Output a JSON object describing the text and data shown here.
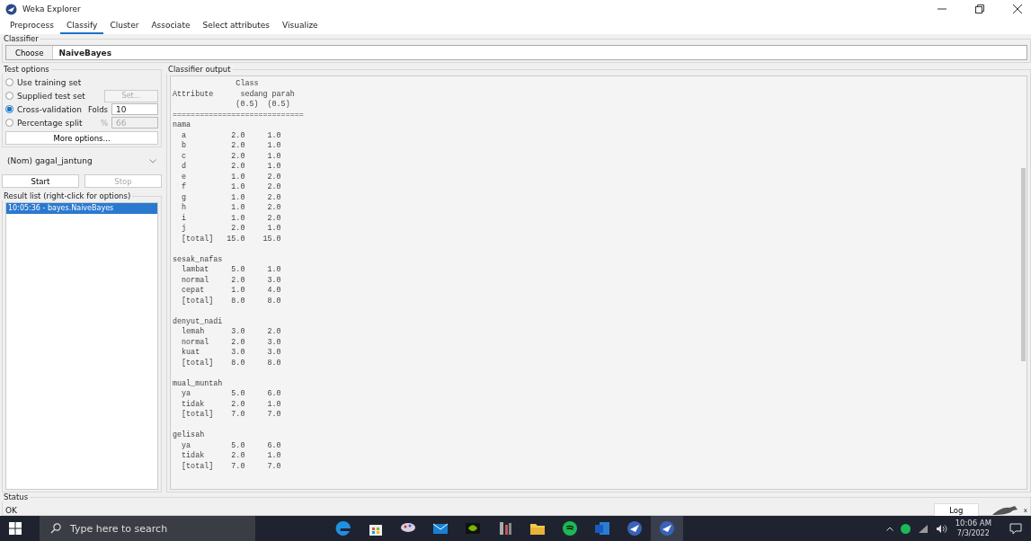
{
  "window": {
    "title": "Weka Explorer"
  },
  "tabs": [
    {
      "label": "Preprocess",
      "selected": false
    },
    {
      "label": "Classify",
      "selected": true
    },
    {
      "label": "Cluster",
      "selected": false
    },
    {
      "label": "Associate",
      "selected": false
    },
    {
      "label": "Select attributes",
      "selected": false
    },
    {
      "label": "Visualize",
      "selected": false
    }
  ],
  "classifier": {
    "title": "Classifier",
    "choose_button": "Choose",
    "name": "NaiveBayes"
  },
  "test_options": {
    "title": "Test options",
    "options": [
      {
        "label": "Use training set",
        "selected": false
      },
      {
        "label": "Supplied test set",
        "selected": false,
        "button": {
          "label": "Set...",
          "disabled": true
        }
      },
      {
        "label": "Cross-validation",
        "selected": true,
        "field": {
          "label": "Folds",
          "value": "10",
          "disabled": false
        }
      },
      {
        "label": "Percentage split",
        "selected": false,
        "field": {
          "label": "%",
          "value": "66",
          "disabled": true
        }
      }
    ],
    "more_button": "More options..."
  },
  "class_attribute": "(Nom) gagal_jantung",
  "start_button": {
    "label": "Start",
    "disabled": false
  },
  "stop_button": {
    "label": "Stop",
    "disabled": true
  },
  "result_list": {
    "title": "Result list (right-click for options)",
    "items": [
      {
        "label": "10:05:36 - bayes.NaiveBayes",
        "selected": true
      }
    ]
  },
  "output": {
    "title": "Classifier output",
    "header": [
      "              Class",
      "Attribute      sedang parah",
      "              (0.5)  (0.5)",
      "============================="
    ],
    "sections": [
      {
        "name": "nama",
        "rows": [
          "  a          2.0     1.0",
          "  b          2.0     1.0",
          "  c          2.0     1.0",
          "  d          2.0     1.0",
          "  e          1.0     2.0",
          "  f          1.0     2.0",
          "  g          1.0     2.0",
          "  h          1.0     2.0",
          "  i          1.0     2.0",
          "  j          2.0     1.0",
          "  [total]   15.0    15.0"
        ]
      },
      {
        "name": "sesak_nafas",
        "rows": [
          "  lambat     5.0     1.0",
          "  normal     2.0     3.0",
          "  cepat      1.0     4.0",
          "  [total]    8.0     8.0"
        ]
      },
      {
        "name": "denyut_nadi",
        "rows": [
          "  lemah      3.0     2.0",
          "  normal     2.0     3.0",
          "  kuat       3.0     3.0",
          "  [total]    8.0     8.0"
        ]
      },
      {
        "name": "mual_muntah",
        "rows": [
          "  ya         5.0     6.0",
          "  tidak      2.0     1.0",
          "  [total]    7.0     7.0"
        ]
      },
      {
        "name": "gelisah",
        "rows": [
          "  ya         5.0     6.0",
          "  tidak      2.0     1.0",
          "  [total]    7.0     7.0"
        ]
      }
    ]
  },
  "status": {
    "title": "Status",
    "message": "OK",
    "log_button": "Log",
    "task_count": "x"
  },
  "taskbar": {
    "search_placeholder": "Type here to search",
    "time": "10:06 AM",
    "date": "7/3/2022"
  }
}
